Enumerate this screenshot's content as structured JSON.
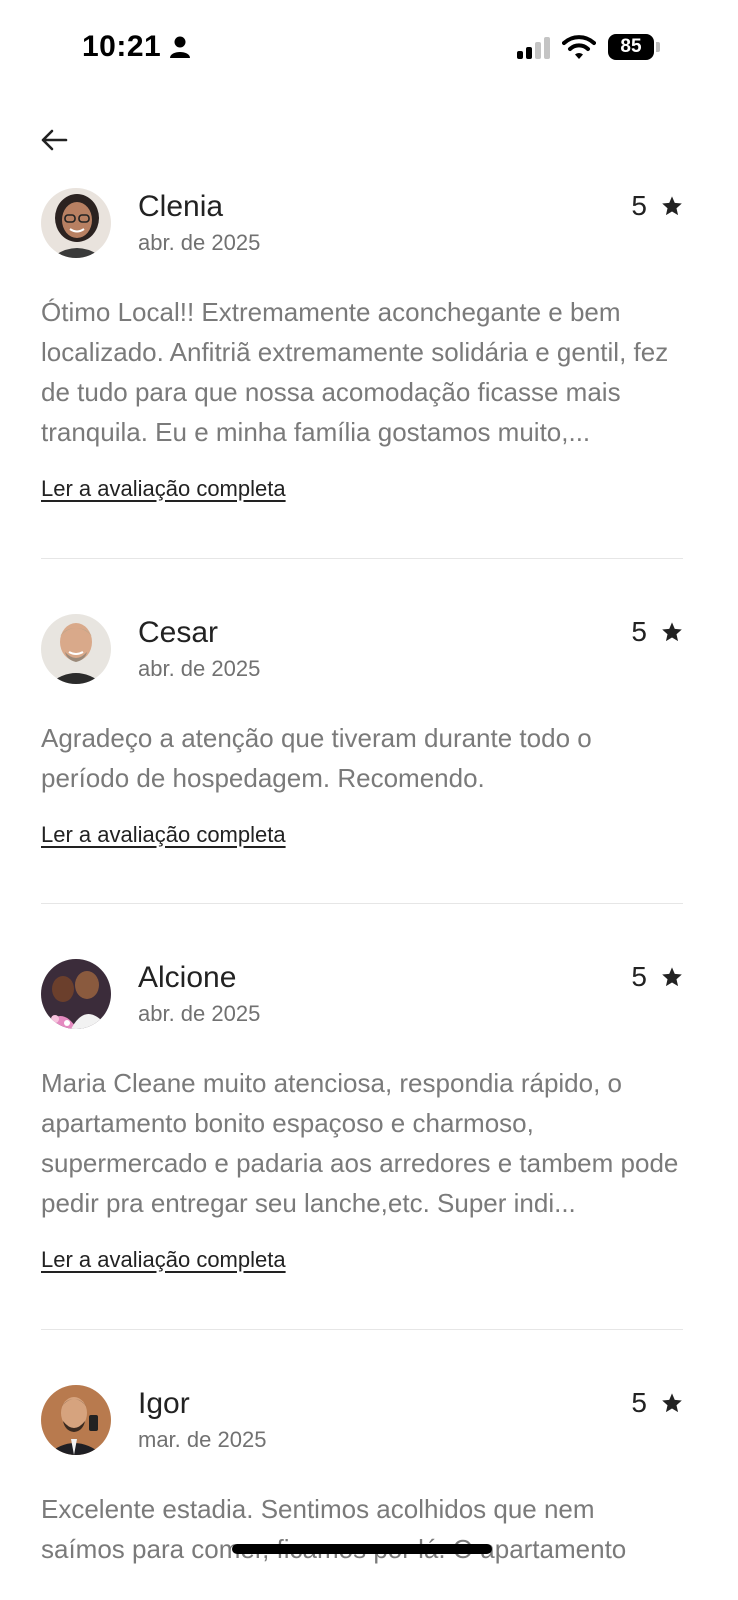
{
  "status_bar": {
    "time": "10:21",
    "battery": "85"
  },
  "reviews": [
    {
      "name": "Clenia",
      "date": "abr. de 2025",
      "rating": "5",
      "text": "Ótimo Local!! Extremamente aconchegante e bem localizado. Anfitriã extremamente solidária e gentil, fez de tudo para que nossa acomodação ficasse mais tranquila. Eu e minha família gostamos muito,...",
      "read_more": "Ler a avaliação completa"
    },
    {
      "name": "Cesar",
      "date": "abr. de 2025",
      "rating": "5",
      "text": "Agradeço a atenção que tiveram durante todo o período de hospedagem. Recomendo.",
      "read_more": "Ler a avaliação completa"
    },
    {
      "name": "Alcione",
      "date": "abr. de 2025",
      "rating": "5",
      "text": "Maria Cleane muito atenciosa, respondia rápido, o apartamento bonito espaçoso e charmoso, supermercado e padaria aos arredores e tambem pode pedir pra entregar seu lanche,etc. Super indi...",
      "read_more": "Ler a avaliação completa"
    },
    {
      "name": "Igor",
      "date": "mar. de 2025",
      "rating": "5",
      "text": "Excelente estadia. Sentimos acolhidos que nem saímos para comer, ficamos por lá. O apartamento"
    }
  ],
  "icons": {
    "back": "back-arrow-icon",
    "star": "star-icon",
    "person": "person-icon",
    "wifi": "wifi-icon",
    "signal": "cellular-signal-icon"
  },
  "colors": {
    "text_primary": "#222222",
    "text_secondary": "#717171",
    "divider": "#e6e6e6"
  }
}
